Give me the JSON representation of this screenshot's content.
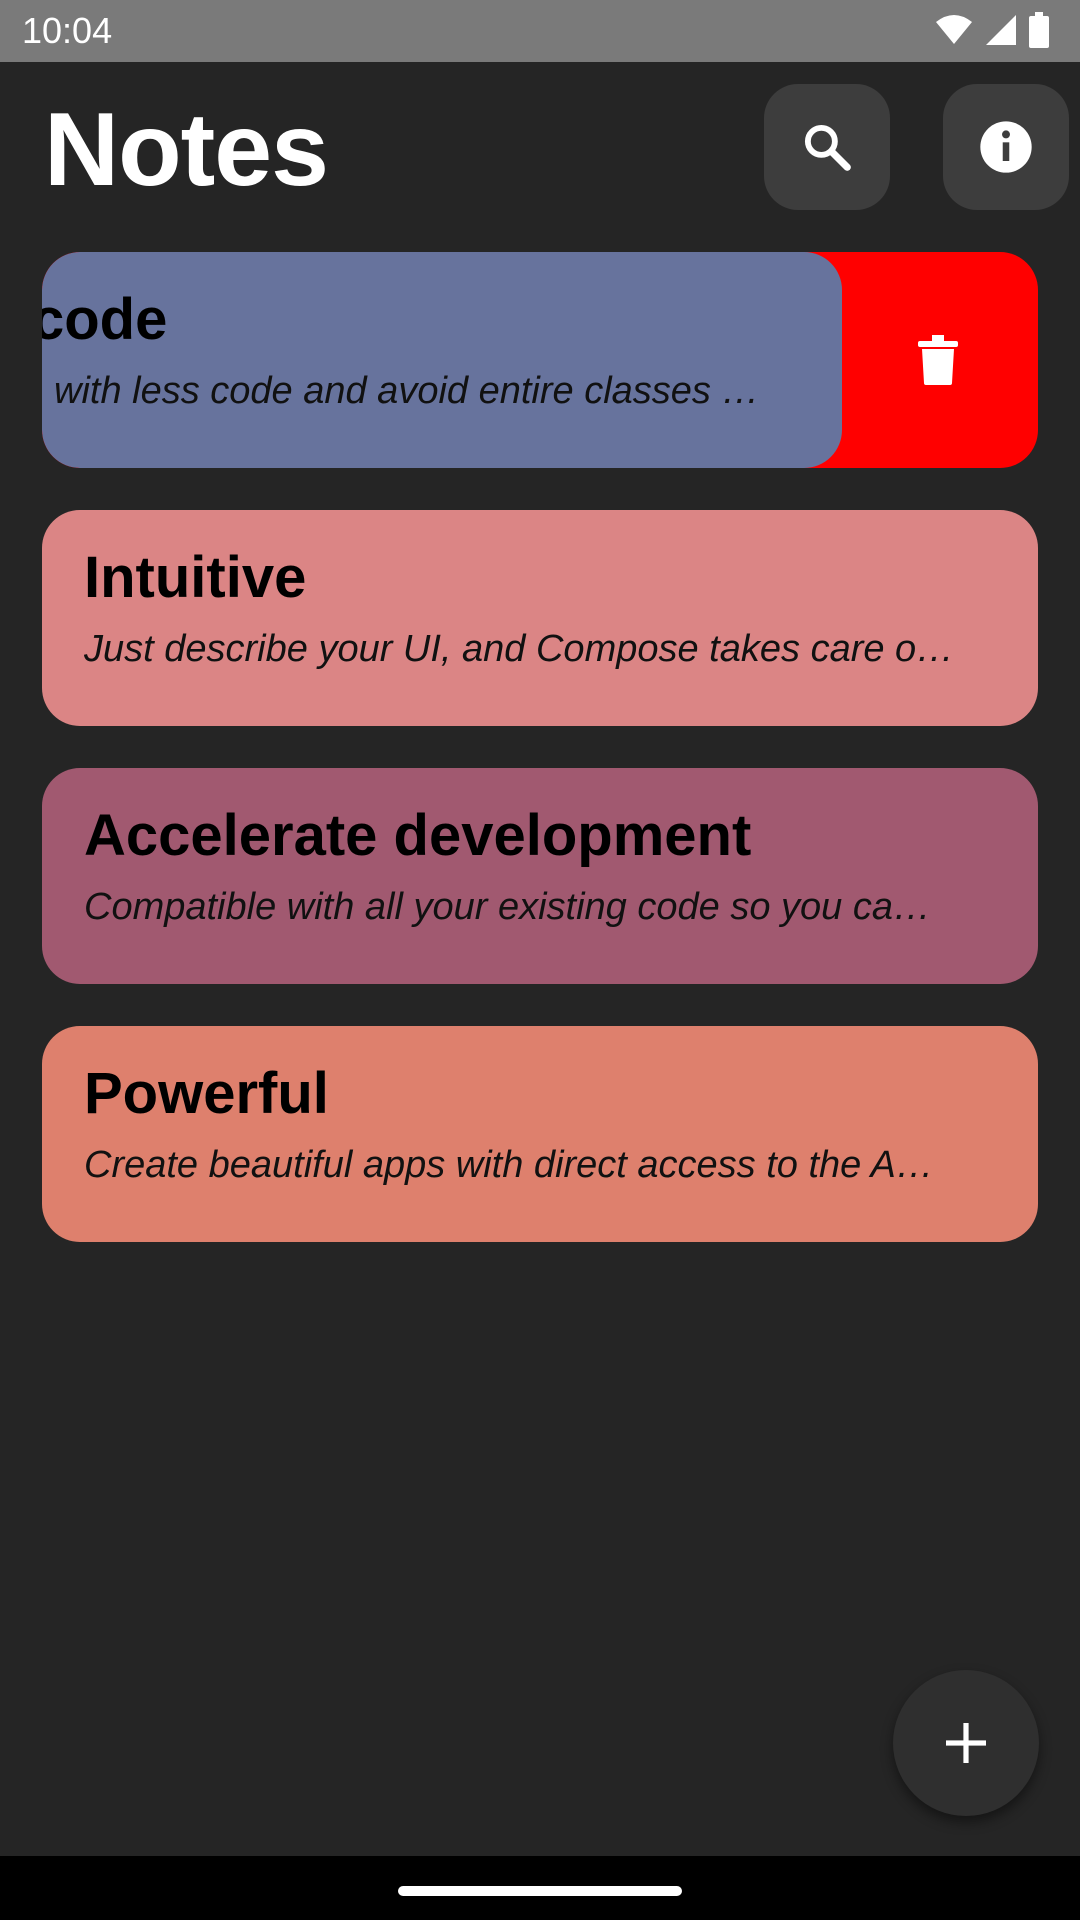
{
  "status_bar": {
    "time": "10:04"
  },
  "header": {
    "title": "Notes",
    "search_icon": "search-icon",
    "info_icon": "info-icon"
  },
  "notes": [
    {
      "title": "code",
      "body": "with less code and avoid entire classes …",
      "color": "#67739d",
      "swiped": true
    },
    {
      "title": "Intuitive",
      "body": "Just describe your UI, and Compose takes care o…",
      "color": "#db8585",
      "swiped": false
    },
    {
      "title": "Accelerate development",
      "body": "Compatible with all your existing code so you ca…",
      "color": "#a15970",
      "swiped": false
    },
    {
      "title": "Powerful",
      "body": "Create beautiful apps with direct access to the A…",
      "color": "#de806d",
      "swiped": false
    }
  ],
  "delete_action": {
    "color": "#ff0000",
    "icon": "trash-icon"
  },
  "fab": {
    "icon": "plus-icon"
  }
}
